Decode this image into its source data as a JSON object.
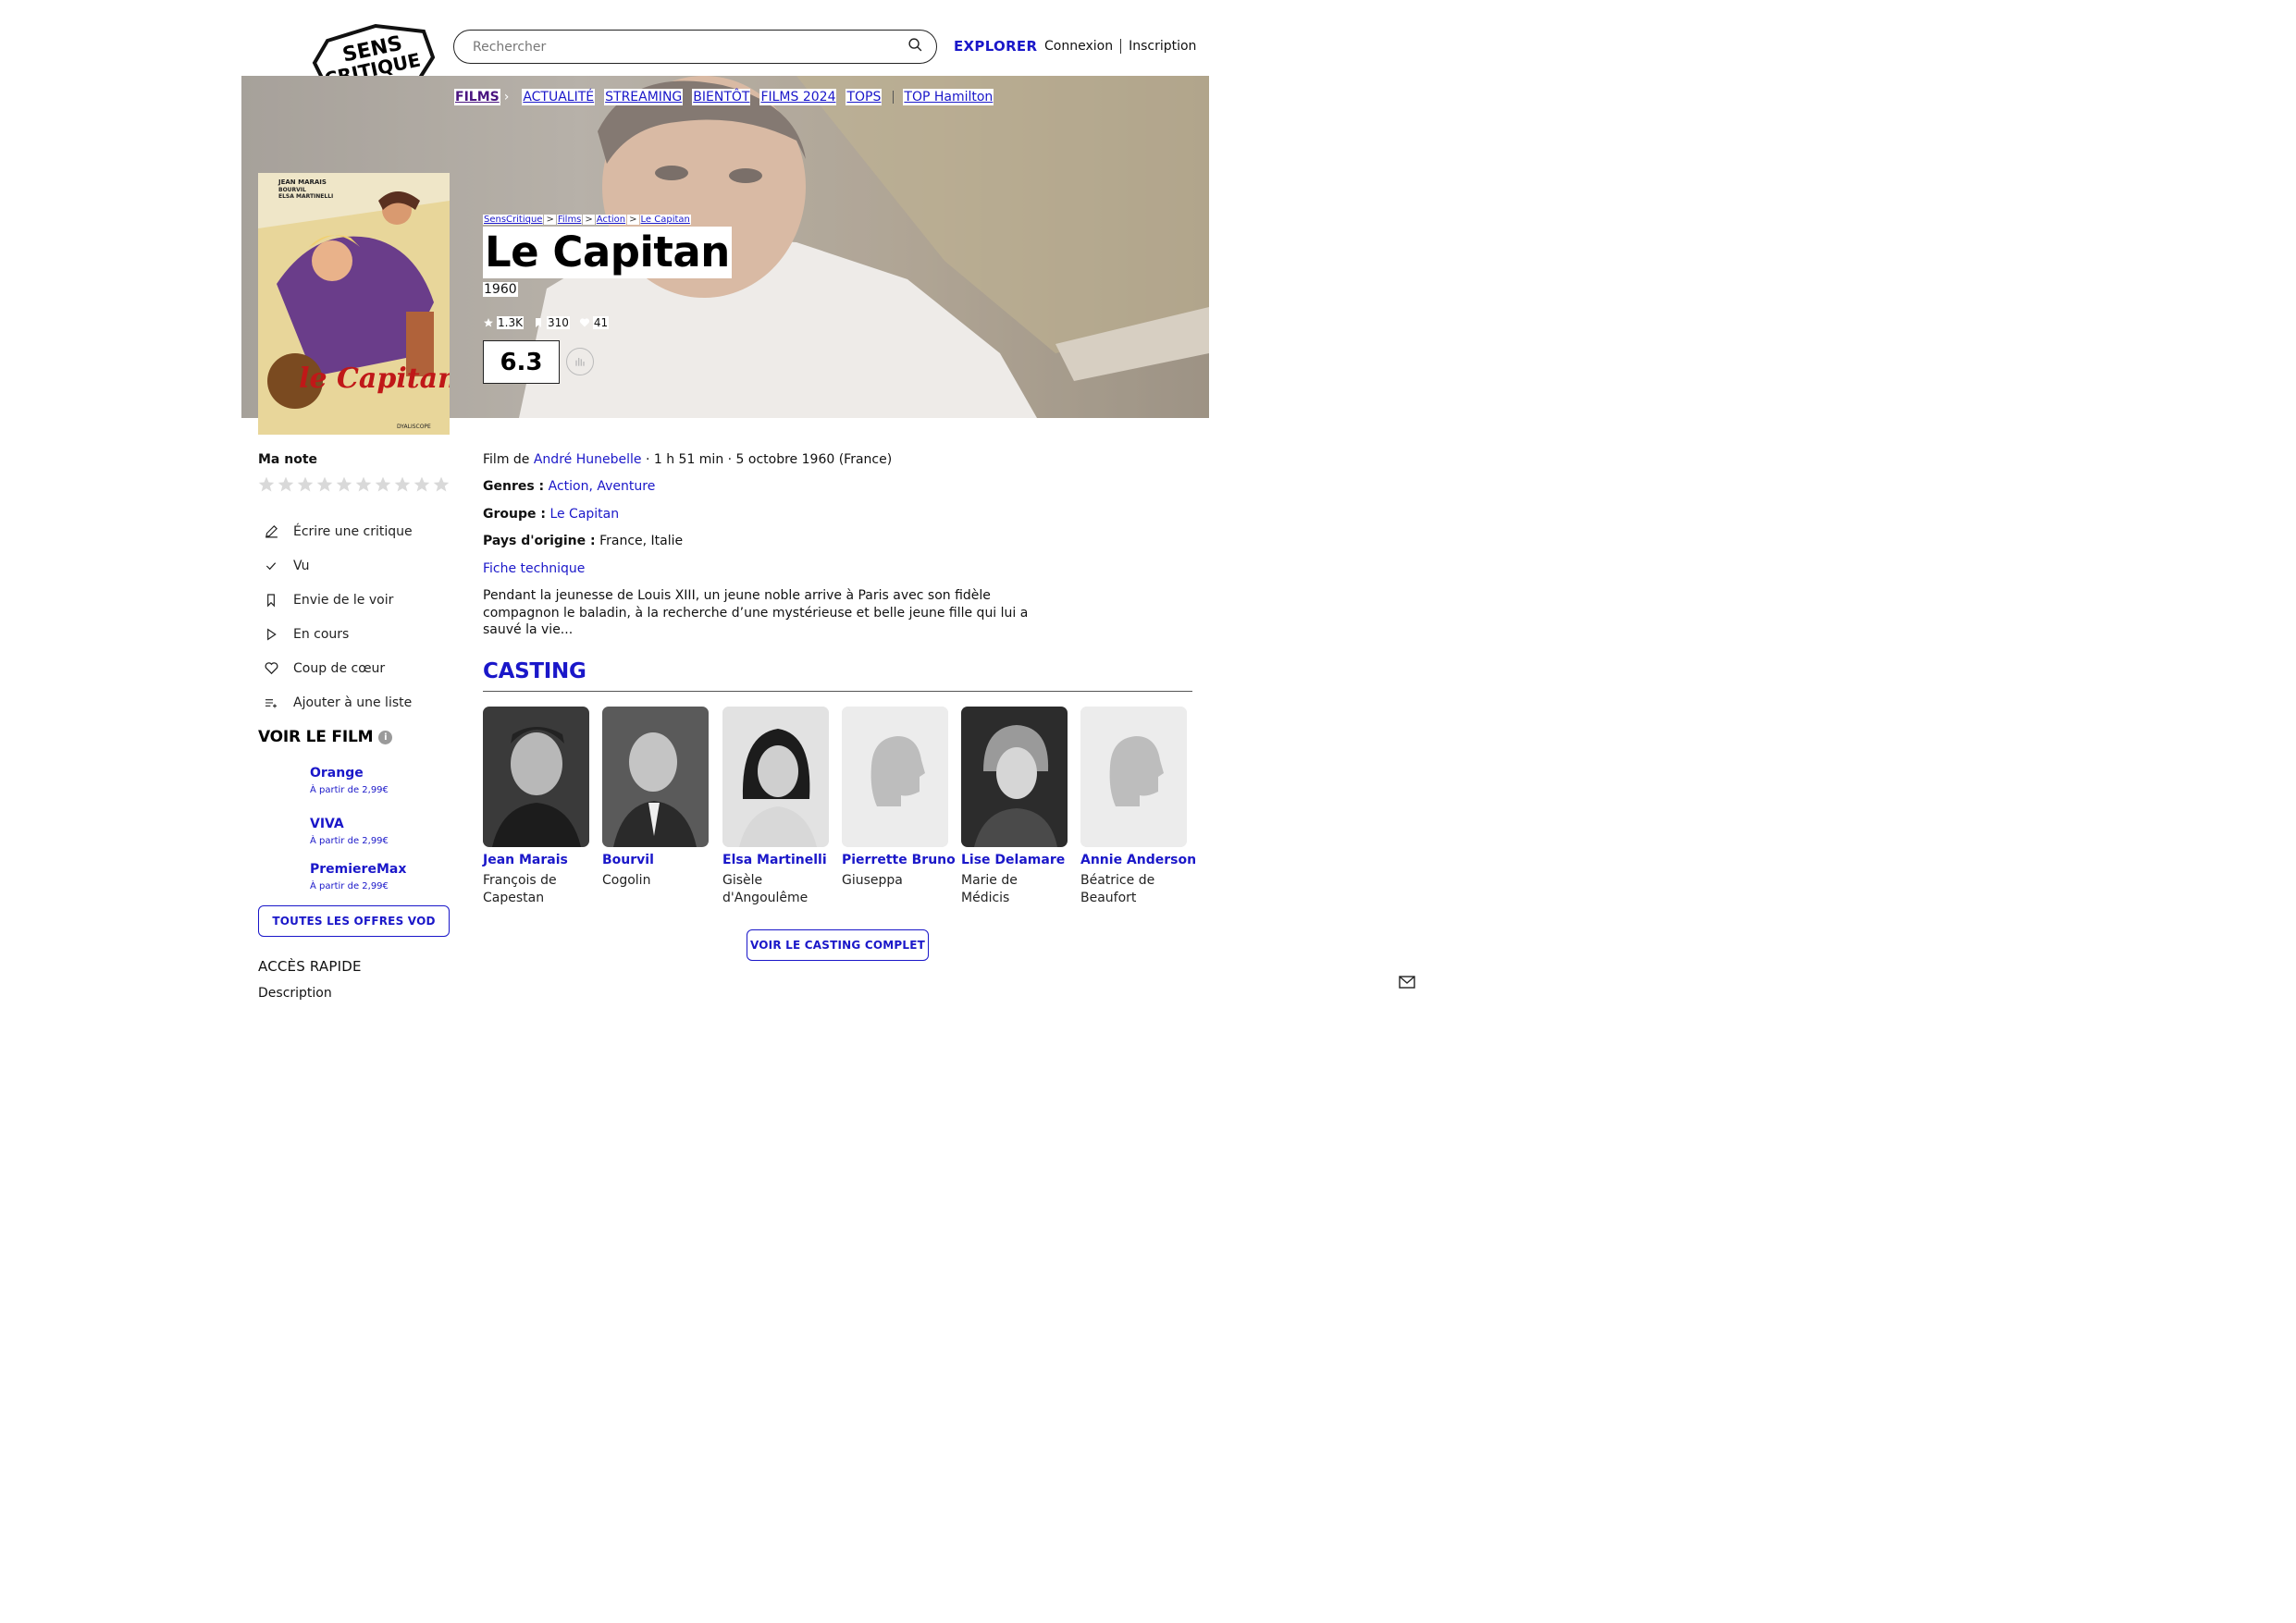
{
  "header": {
    "logo_text": "SENS CRITIQUE",
    "search_placeholder": "Rechercher",
    "explorer_label": "EXPLORER",
    "login_label": "Connexion",
    "signup_label": "Inscription"
  },
  "nav": {
    "active": "FILMS",
    "items": [
      "ACTUALITÉ",
      "STREAMING",
      "BIENTÔT",
      "FILMS 2024",
      "TOPS"
    ],
    "extra": "TOP Hamilton"
  },
  "breadcrumb": [
    "SensCritique",
    "Films",
    "Action",
    "Le Capitan"
  ],
  "film": {
    "title": "Le Capitan",
    "year": "1960",
    "stats": {
      "ratings": "1.3K",
      "wishlist": "310",
      "favorites": "41"
    },
    "score": "6.3",
    "poster_text": "le Capitan",
    "director_prefix": "Film de",
    "director": "André Hunebelle",
    "details": "· 1 h 51 min · 5 octobre 1960 (France)",
    "genres_label": "Genres :",
    "genres": "Action, Aventure",
    "group_label": "Groupe :",
    "group": "Le Capitan",
    "country_label": "Pays d'origine :",
    "countries": "France, Italie",
    "fiche_label": "Fiche technique",
    "synopsis": "Pendant la jeunesse de Louis XIII, un jeune noble arrive à Paris avec son fidèle compagnon le baladin, à la recherche d’une mystérieuse et belle jeune fille qui lui a sauvé la vie..."
  },
  "sidebar": {
    "ma_note": "Ma note",
    "actions": [
      {
        "icon": "pencil-icon",
        "label": "Écrire une critique"
      },
      {
        "icon": "check-icon",
        "label": "Vu"
      },
      {
        "icon": "bookmark-icon",
        "label": "Envie de le voir"
      },
      {
        "icon": "play-icon",
        "label": "En cours"
      },
      {
        "icon": "heart-icon",
        "label": "Coup de cœur"
      },
      {
        "icon": "add-list-icon",
        "label": "Ajouter à une liste"
      }
    ],
    "voir_title": "VOIR LE FILM",
    "vod": [
      {
        "name": "Orange",
        "price": "À partir de 2,99€"
      },
      {
        "name": "VIVA",
        "price": "À partir de 2,99€"
      },
      {
        "name": "PremiereMax",
        "price": "À partir de 2,99€"
      }
    ],
    "vod_button": "TOUTES LES OFFRES VOD",
    "acces_rapide": "ACCÈS RAPIDE",
    "description_link": "Description"
  },
  "casting": {
    "title": "CASTING",
    "members": [
      {
        "name": "Jean Marais",
        "role": "François de Capestan",
        "has_photo": true
      },
      {
        "name": "Bourvil",
        "role": "Cogolin",
        "has_photo": true
      },
      {
        "name": "Elsa Martinelli",
        "role": "Gisèle d'Angoulême",
        "has_photo": true
      },
      {
        "name": "Pierrette Bruno",
        "role": "Giuseppa",
        "has_photo": false
      },
      {
        "name": "Lise Delamare",
        "role": "Marie de Médicis",
        "has_photo": true
      },
      {
        "name": "Annie Anderson",
        "role": "Béatrice de Beaufort",
        "has_photo": false
      }
    ],
    "button": "VOIR LE CASTING COMPLET"
  },
  "colors": {
    "link": "#1a17c9",
    "nav_active": "#4a1480",
    "text": "#111111"
  }
}
